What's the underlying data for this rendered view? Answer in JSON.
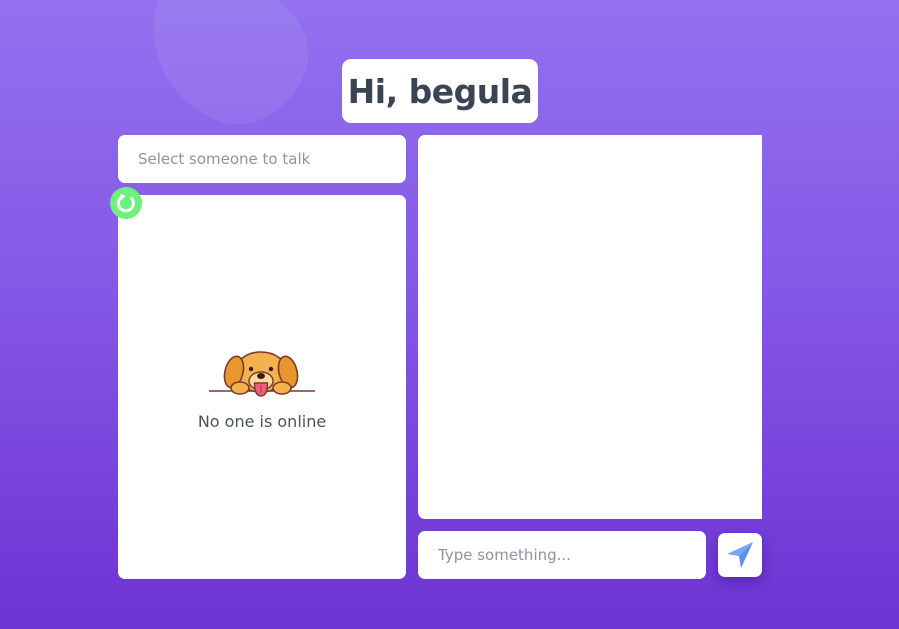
{
  "header": {
    "greeting": "Hi, begula"
  },
  "user_select": {
    "placeholder": "Select someone to talk"
  },
  "users_panel": {
    "empty_message": "No one is online",
    "empty_illustration": "puppy-icon",
    "refresh_icon": "refresh-icon"
  },
  "composer": {
    "placeholder": "Type something...",
    "send_icon": "send-icon"
  },
  "colors": {
    "background_top": "#9371ef",
    "background_bottom": "#6d33d3",
    "refresh_button": "#6ff07a",
    "send_icon": "#5b8cf0",
    "text_dark": "#3b4452",
    "text_muted": "#8d94a0"
  }
}
